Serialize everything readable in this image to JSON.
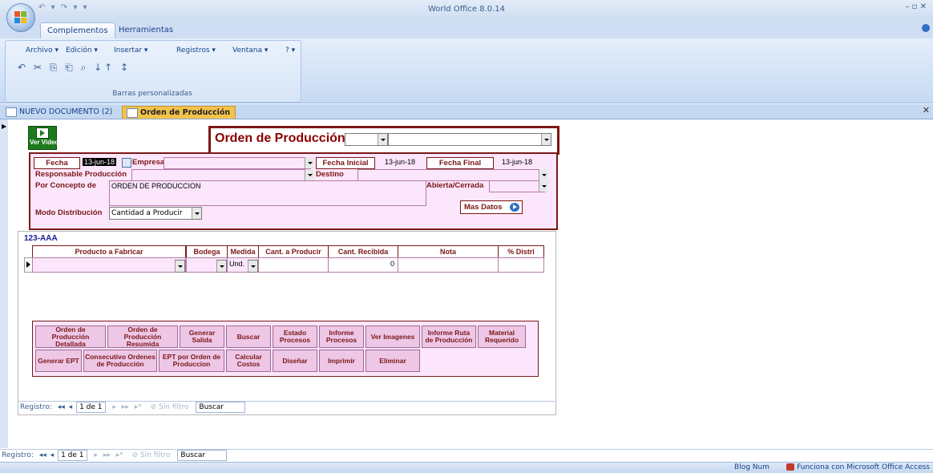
{
  "app": {
    "title": "World Office 8.0.14"
  },
  "window": {
    "controls": "–  ▫  ✕"
  },
  "quick_access": "↶ ▾  ↷ ▾  ▾",
  "ribbon": {
    "tabs": [
      "Complementos",
      "Herramientas"
    ],
    "menus": [
      "Archivo ▾",
      "Edición ▾",
      "Insertar ▾",
      "Registros ▾",
      "Ventana ▾",
      "? ▾"
    ],
    "toolbar_icons": [
      "undo-icon",
      "cut-icon",
      "copy-icon",
      "paste-icon",
      "find-icon",
      "sort-asc-icon",
      "sort-desc-icon"
    ],
    "tool_glyphs": "↶ ✂ ⎘ ⎗ ⌕ ↓↑ ↕",
    "group_caption": "Barras personalizadas"
  },
  "doc_tabs": [
    "NUEVO DOCUMENTO (2)",
    "Orden de Producción"
  ],
  "form": {
    "ver_video": "Ver Video",
    "title": "Orden de Producción",
    "fecha_label": "Fecha",
    "fecha_value": "13-jun-18",
    "empresa_label": "Empresa",
    "fecha_inicial_label": "Fecha Inicial",
    "fecha_inicial_value": "13-jun-18",
    "fecha_final_label": "Fecha Final",
    "fecha_final_value": "13-jun-18",
    "responsable_label": "Responsable Producción",
    "destino_label": "Destino",
    "concepto_label": "Por Concepto de",
    "concepto_value": "ORDEN DE PRODUCCION",
    "abierta_label": "Abierta/Cerrada",
    "modo_label": "Modo Distribución",
    "modo_value": "Cantidad a Producir",
    "mas_datos": "Mas Datos"
  },
  "subform": {
    "code": "123-AAA",
    "columns": [
      "Producto a Fabricar",
      "Bodega",
      "Medida",
      "Cant. a Producir",
      "Cant. Recibida",
      "Nota",
      "% Distri"
    ],
    "row": {
      "medida": "Und.",
      "cant_recibida": "0"
    }
  },
  "buttons_row1": [
    "Orden de Producción Detallada",
    "Orden de Producción Resumida",
    "Generar Salida",
    "Buscar",
    "Estado Procesos",
    "Informe Procesos",
    "Ver Imagenes",
    "Informe Ruta de Producción",
    "Material Requerido"
  ],
  "buttons_row2": [
    "Generar EPT",
    "Consecutivo Ordenes de Producción",
    "EPT por Orden de Produccion",
    "Calcular Costos",
    "Diseñar",
    "Imprimir",
    "Eliminar"
  ],
  "nav_inner": {
    "label": "Registro:",
    "first": "◂◂",
    "prev": "◂",
    "position": "1 de 1",
    "next": "▸",
    "last": "▸▸",
    "new": "▸*",
    "filter": "Sin filtro",
    "search": "Buscar"
  },
  "nav_outer": {
    "label": "Registro:",
    "first": "◂◂",
    "prev": "◂",
    "position": "1 de 1",
    "next": "▸",
    "last": "▸▸",
    "new": "▸*",
    "filter": "Sin filtro",
    "search": "Buscar"
  },
  "status": {
    "blog_num": "Blog Num",
    "access": "Funciona con Microsoft Office Access"
  },
  "colors": {
    "accent": "#7a1717",
    "pink_panel": "#fbe6fb",
    "ribbon": "#cfdef2",
    "active_tab": "#f3c24d"
  }
}
